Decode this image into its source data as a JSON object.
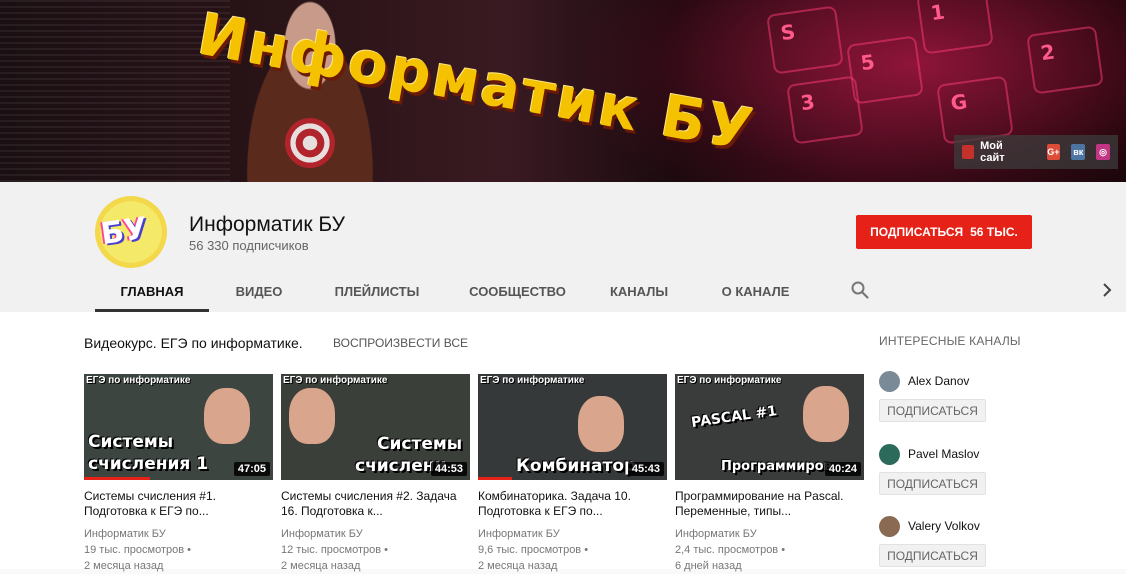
{
  "banner": {
    "brand_text": "Информатик БУ",
    "keys": [
      "S",
      "5",
      "G",
      "3",
      "1",
      "2"
    ],
    "links": {
      "site_label": "Мой сайт",
      "social": [
        "G+",
        "вк",
        "◎"
      ]
    }
  },
  "channel": {
    "avatar_text": "БУ",
    "title": "Информатик БУ",
    "subscribers": "56 330 подписчиков",
    "subscribe_label": "Подписаться",
    "subscribe_count": "56 тыс."
  },
  "tabs": [
    {
      "label": "Главная",
      "active": true
    },
    {
      "label": "Видео"
    },
    {
      "label": "Плейлисты"
    },
    {
      "label": "Сообщество"
    },
    {
      "label": "Каналы"
    },
    {
      "label": "О канале"
    }
  ],
  "shelf": {
    "title": "Видеокурс. ЕГЭ по информатике.",
    "play_all": "Воспроизвести все"
  },
  "videos": [
    {
      "thumb_tag": "ЕГЭ по информатике",
      "thumb_text": [
        "Системы",
        "счисления 1"
      ],
      "duration": "47:05",
      "progress": 0.35,
      "bg": "#3c4540",
      "title": "Системы счисления #1. Подготовка к ЕГЭ по...",
      "channel": "Информатик БУ",
      "views": "19 тыс. просмотров",
      "age": "2 месяца назад"
    },
    {
      "thumb_tag": "ЕГЭ по информатике",
      "thumb_text": [
        "Системы",
        "счислени"
      ],
      "duration": "44:53",
      "progress": 0,
      "bg": "#3a3f3a",
      "title": "Системы счисления #2. Задача 16. Подготовка к...",
      "channel": "Информатик БУ",
      "views": "12 тыс. просмотров",
      "age": "2 месяца назад"
    },
    {
      "thumb_tag": "ЕГЭ по информатике",
      "thumb_text": [
        "Комбинатор"
      ],
      "duration": "45:43",
      "progress": 0.18,
      "bg": "#35393a",
      "title": "Комбинаторика. Задача 10. Подготовка к ЕГЭ по...",
      "channel": "Информатик БУ",
      "views": "9,6 тыс. просмотров",
      "age": "2 месяца назад"
    },
    {
      "thumb_tag": "ЕГЭ по информатике",
      "thumb_text": [
        "PASCAL #1",
        "Программиров"
      ],
      "duration": "40:24",
      "progress": 0,
      "bg": "#393c3a",
      "title": "Программирование на Pascal. Переменные, типы...",
      "channel": "Информатик БУ",
      "views": "2,4 тыс. просмотров",
      "age": "6 дней назад"
    }
  ],
  "sidebar": {
    "title": "Интересные каналы",
    "channels": [
      {
        "name": "Alex Danov",
        "button": "Подписаться",
        "color": "#7a8a96"
      },
      {
        "name": "Pavel Maslov",
        "button": "Подписаться",
        "color": "#2c6b5c"
      },
      {
        "name": "Valery Volkov",
        "button": "Подписаться",
        "color": "#8a6a52"
      }
    ]
  }
}
